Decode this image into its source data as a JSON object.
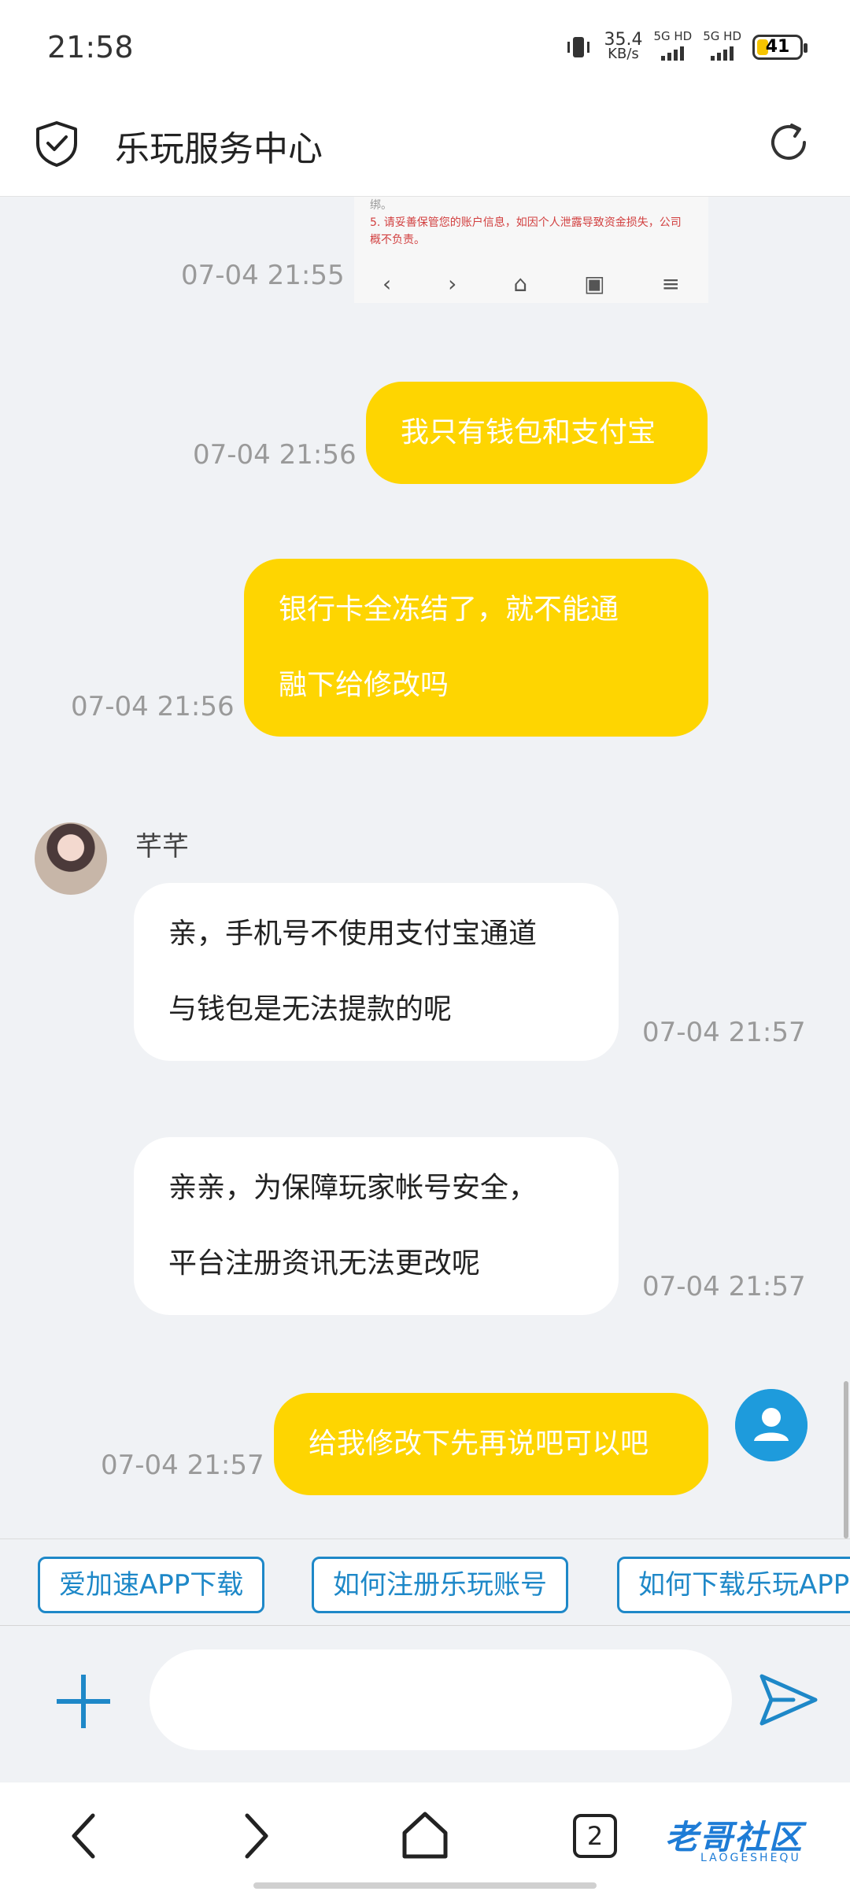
{
  "status_bar": {
    "time": "21:58",
    "speed_value": "35.4",
    "speed_unit": "KB/s",
    "network_1": "5G HD",
    "network_2": "5G HD",
    "battery": "41"
  },
  "header": {
    "title": "乐玩服务中心"
  },
  "thumbnail": {
    "line_top": "绑。",
    "line_1": "5. 请妥善保管您的账户信息，如因个人泄露导致资金损失，公司",
    "line_2": "概不负责。"
  },
  "messages": [
    {
      "from": "me",
      "time": "07-04 21:55",
      "text": ""
    },
    {
      "from": "me",
      "time": "07-04 21:56",
      "text": "我只有钱包和支付宝"
    },
    {
      "from": "me",
      "time": "07-04 21:56",
      "line1": "银行卡全冻结了，就不能通",
      "line2": "融下给修改吗"
    },
    {
      "from": "agent",
      "name": "芊芊",
      "time": "07-04 21:57",
      "line1": "亲，手机号不使用支付宝通道",
      "line2": "与钱包是无法提款的呢"
    },
    {
      "from": "agent",
      "time": "07-04 21:57",
      "line1": "亲亲，为保障玩家帐号安全，",
      "line2": "平台注册资讯无法更改呢"
    },
    {
      "from": "me",
      "time": "07-04 21:57",
      "text": "给我修改下先再说吧可以吧"
    }
  ],
  "quick_replies": [
    "爱加速APP下载",
    "如何注册乐玩账号",
    "如何下载乐玩APP"
  ],
  "input": {
    "placeholder": ""
  },
  "navbar": {
    "tabs_count": "2"
  },
  "watermark": {
    "text": "老哥社区",
    "sub": "LAOGESHEQU"
  },
  "colors": {
    "accent_blue": "#1e88c8",
    "my_bubble": "#fed501"
  }
}
